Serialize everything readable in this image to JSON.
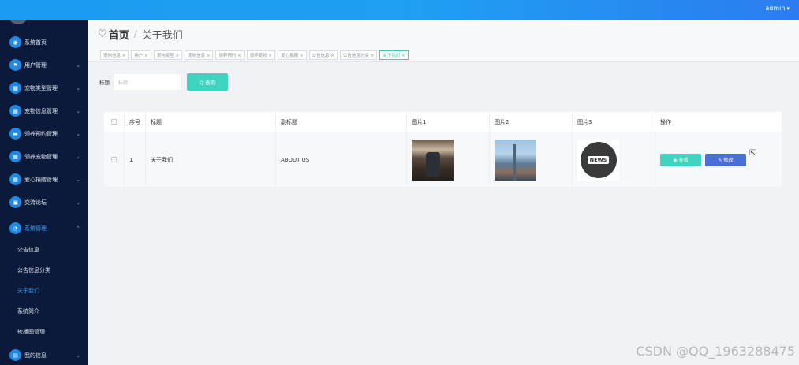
{
  "topbar": {
    "user": "admin",
    "user_caret": "▾"
  },
  "sidebar": {
    "items": [
      {
        "label": "系统首页",
        "icon": "◉",
        "arrow": ""
      },
      {
        "label": "用户管理",
        "icon": "⚑",
        "arrow": "⌄"
      },
      {
        "label": "宠物类型管理",
        "icon": "▦",
        "arrow": "⌄"
      },
      {
        "label": "宠物信息管理",
        "icon": "▦",
        "arrow": "⌄"
      },
      {
        "label": "领养预约管理",
        "icon": "▬",
        "arrow": "⌄"
      },
      {
        "label": "领养宠物管理",
        "icon": "▦",
        "arrow": "⌄"
      },
      {
        "label": "爱心捐赠管理",
        "icon": "▦",
        "arrow": "⌄"
      },
      {
        "label": "交流论坛",
        "icon": "▣",
        "arrow": "⌄"
      },
      {
        "label": "系统管理",
        "icon": "◔",
        "arrow": "⌃"
      }
    ],
    "sub_items": [
      "公告信息",
      "公告信息分类",
      "关于我们",
      "系统简介",
      "轮播图管理"
    ],
    "last_item": {
      "label": "我的信息",
      "icon": "▤",
      "arrow": "⌄"
    }
  },
  "header": {
    "heart": "♡",
    "home": "首页",
    "separator": "/",
    "current": "关于我们"
  },
  "tags": [
    "宠物信息 ×",
    "用户 ×",
    "宠物类型 ×",
    "宠物信息 ×",
    "领养预约 ×",
    "领养宠物 ×",
    "爱心捐赠 ×",
    "公告信息 ×",
    "公告信息分类 ×",
    "关于我们 ×"
  ],
  "search": {
    "label": "标题",
    "placeholder": "标题",
    "button": "Q 查询"
  },
  "table": {
    "headers": [
      "",
      "序号",
      "标题",
      "副标题",
      "图片1",
      "图片2",
      "图片3",
      "操作"
    ],
    "rows": [
      {
        "index": "1",
        "title": "关于我们",
        "subtitle": "ABOUT US",
        "img3_text": "NEWS",
        "view": "◉ 查看",
        "edit": "✎ 修改"
      }
    ]
  },
  "cursor": "⇱",
  "watermark": "CSDN @QQ_1963288475",
  "colors": {
    "accent": "#40d3c0",
    "edit": "#4b6fd8",
    "sidebar": "#0b1a3a",
    "topbar": "#1ea1f2"
  }
}
